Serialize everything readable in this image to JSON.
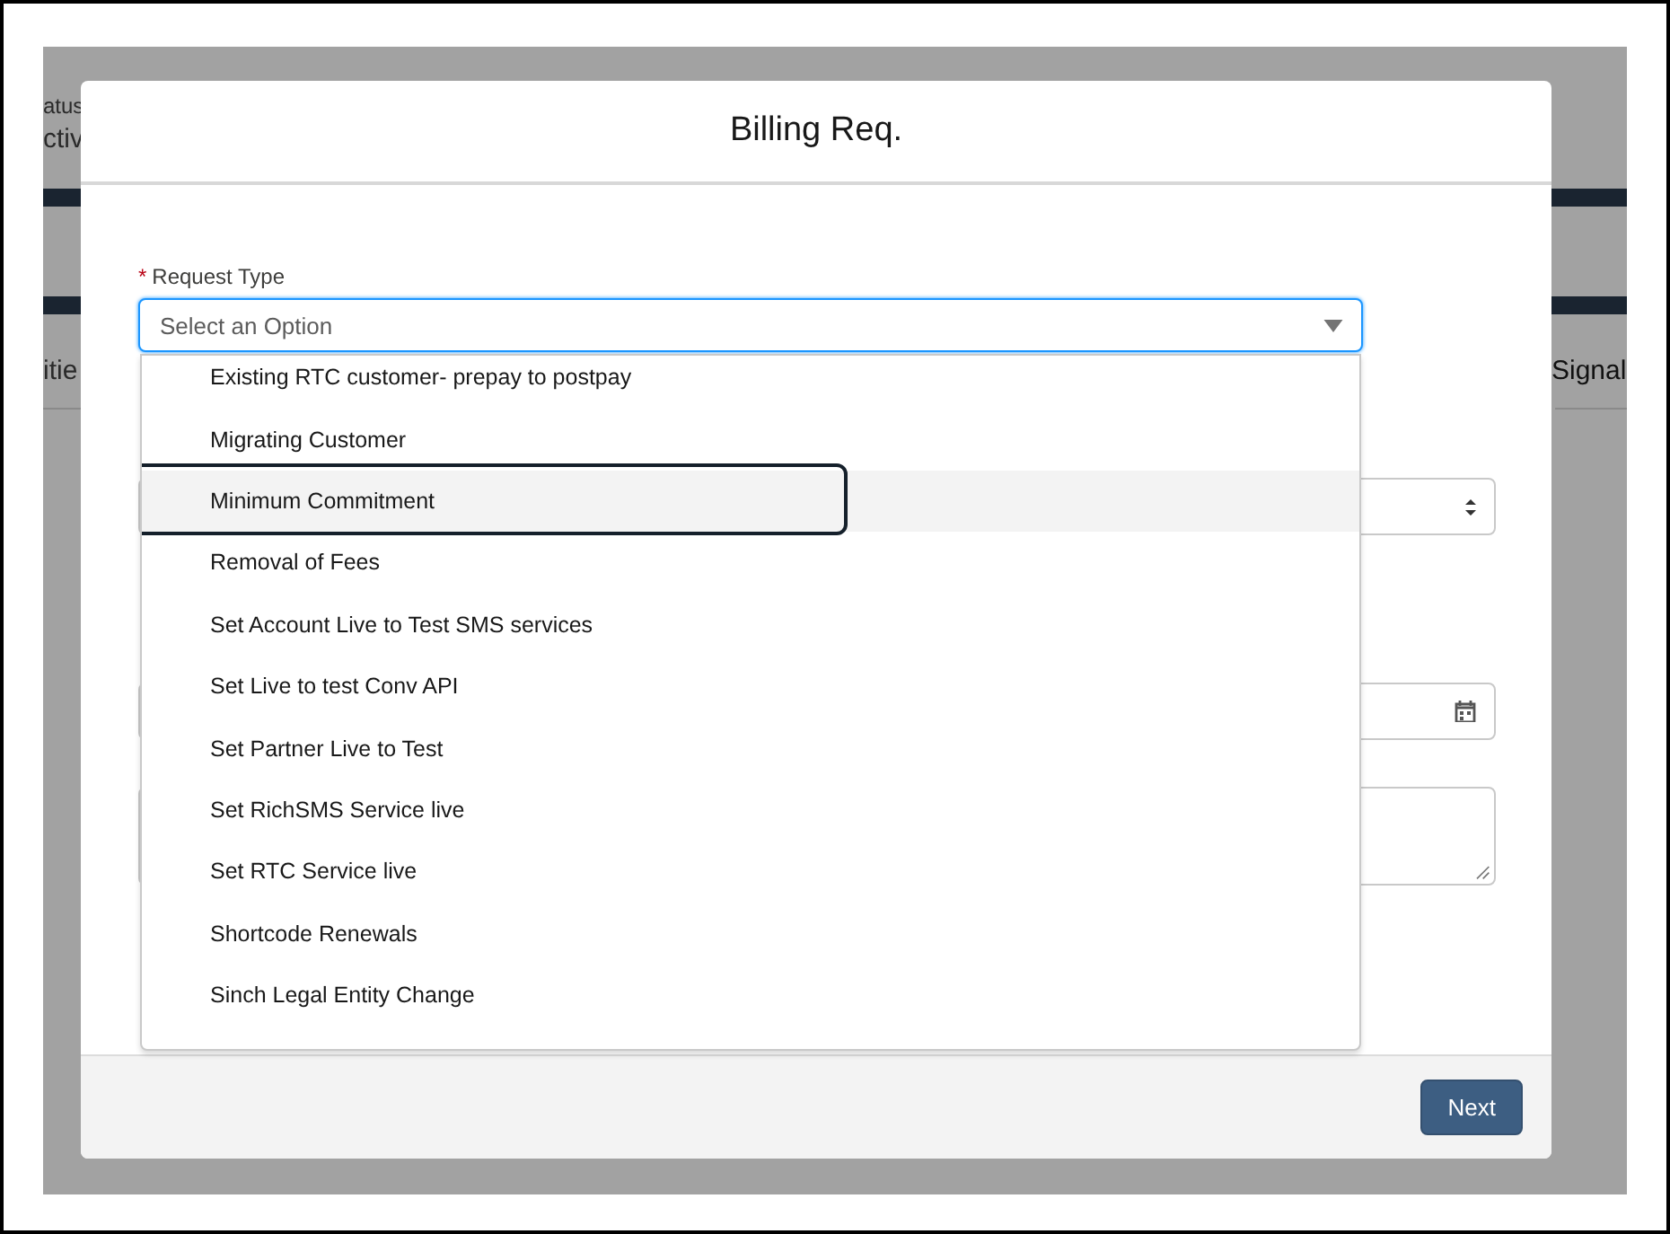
{
  "background_page": {
    "texts": [
      {
        "kind": "status-label",
        "text": "atus"
      },
      {
        "kind": "status-value",
        "text": "ctiv"
      },
      {
        "kind": "tab-left",
        "text": "itie"
      },
      {
        "kind": "tab-right",
        "text": "Signal"
      }
    ]
  },
  "modal": {
    "title": "Billing Req.",
    "request_type": {
      "label": "Request Type",
      "required": true,
      "required_mark": "*",
      "placeholder": "Select an Option",
      "expanded": true,
      "options": [
        {
          "label": "Existing RTC customer- prepay to postpay",
          "selected": false
        },
        {
          "label": "Migrating Customer",
          "selected": false
        },
        {
          "label": "Minimum Commitment",
          "selected": true
        },
        {
          "label": "Removal of Fees",
          "selected": false
        },
        {
          "label": "Set Account Live to Test SMS services",
          "selected": false
        },
        {
          "label": "Set Live to test Conv API",
          "selected": false
        },
        {
          "label": "Set Partner Live to Test",
          "selected": false
        },
        {
          "label": "Set RichSMS Service live",
          "selected": false
        },
        {
          "label": "Set RTC Service live",
          "selected": false
        },
        {
          "label": "Shortcode Renewals",
          "selected": false
        },
        {
          "label": "Sinch Legal Entity Change",
          "selected": false
        }
      ]
    },
    "fields": [
      {
        "kind": "select"
      },
      {
        "kind": "date"
      },
      {
        "kind": "textarea"
      }
    ],
    "buttons": [
      {
        "label": "Next",
        "kind": "brand"
      }
    ]
  }
}
